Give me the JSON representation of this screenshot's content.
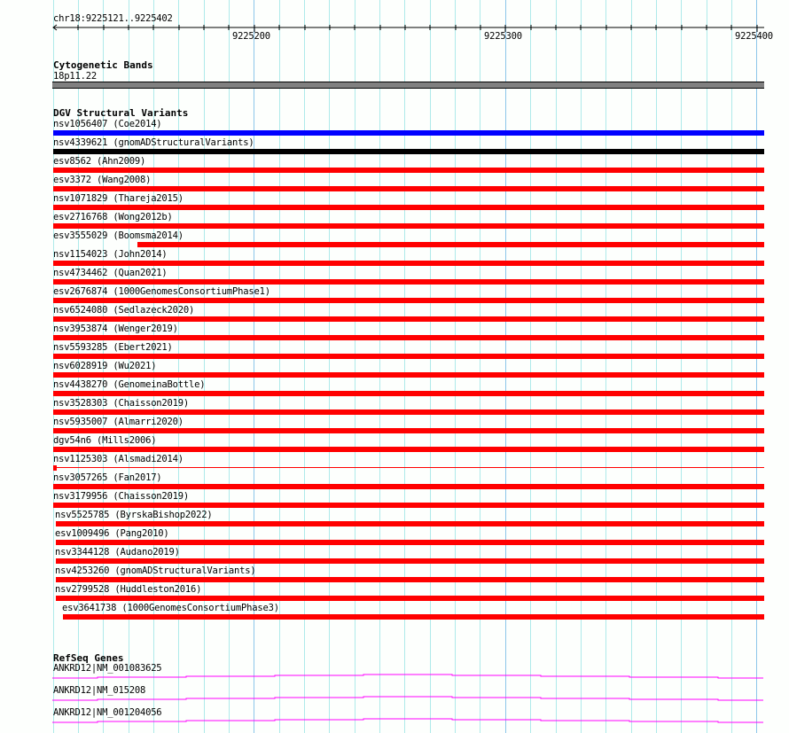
{
  "ruler": {
    "position": "chr18:9225121..9225402",
    "ticks": [
      "9225200",
      "9225300",
      "9225400"
    ]
  },
  "cytoband": {
    "title": "Cytogenetic Bands",
    "band": "18p11.22",
    "color": "#808080"
  },
  "dgv": {
    "title": "DGV Structural Variants",
    "variants": [
      {
        "label": "nsv1056407 (Coe2014)",
        "color": "#0000ff"
      },
      {
        "label": "nsv4339621 (gnomADStructuralVariants)",
        "color": "#000000"
      },
      {
        "label": "esv8562 (Ahn2009)",
        "color": "#ff0000"
      },
      {
        "label": "esv3372 (Wang2008)",
        "color": "#ff0000"
      },
      {
        "label": "nsv1071829 (Thareja2015)",
        "color": "#ff0000"
      },
      {
        "label": "esv2716768 (Wong2012b)",
        "color": "#ff0000"
      },
      {
        "label": "esv3555029 (Boomsma2014)",
        "color": "#ff0000"
      },
      {
        "label": "nsv1154023 (John2014)",
        "color": "#ff0000"
      },
      {
        "label": "nsv4734462 (Quan2021)",
        "color": "#ff0000"
      },
      {
        "label": "esv2676874 (1000GenomesConsortiumPhase1)",
        "color": "#ff0000"
      },
      {
        "label": "nsv6524080 (Sedlazeck2020)",
        "color": "#ff0000"
      },
      {
        "label": "nsv3953874 (Wenger2019)",
        "color": "#ff0000"
      },
      {
        "label": "nsv5593285 (Ebert2021)",
        "color": "#ff0000"
      },
      {
        "label": "nsv6028919 (Wu2021)",
        "color": "#ff0000"
      },
      {
        "label": "nsv4438270 (GenomeinaBottle)",
        "color": "#ff0000"
      },
      {
        "label": "nsv3528303 (Chaisson2019)",
        "color": "#ff0000"
      },
      {
        "label": "nsv5935007 (Almarri2020)",
        "color": "#ff0000"
      },
      {
        "label": "dgv54n6 (Mills2006)",
        "color": "#ff0000"
      },
      {
        "label": "nsv1125303 (Alsmadi2014)",
        "color": "#ff0000"
      },
      {
        "label": "nsv3057265 (Fan2017)",
        "color": "#ff0000"
      },
      {
        "label": "nsv3179956 (Chaisson2019)",
        "color": "#ff0000"
      },
      {
        "label": "nsv5525785 (ByrskaBishop2022)",
        "color": "#ff0000"
      },
      {
        "label": "esv1009496 (Pang2010)",
        "color": "#ff0000"
      },
      {
        "label": "nsv3344128 (Audano2019)",
        "color": "#ff0000"
      },
      {
        "label": "nsv4253260 (gnomADStructuralVariants)",
        "color": "#ff0000"
      },
      {
        "label": "nsv2799528 (Huddleston2016)",
        "color": "#ff0000"
      },
      {
        "label": "esv3641738 (1000GenomesConsortiumPhase3)",
        "color": "#ff0000"
      }
    ]
  },
  "refseq": {
    "title": "RefSeq Genes",
    "color": "#ff00ff",
    "genes": [
      {
        "label": "ANKRD12|NM_001083625"
      },
      {
        "label": "ANKRD12|NM_015208"
      },
      {
        "label": "ANKRD12|NM_001204056"
      }
    ]
  }
}
